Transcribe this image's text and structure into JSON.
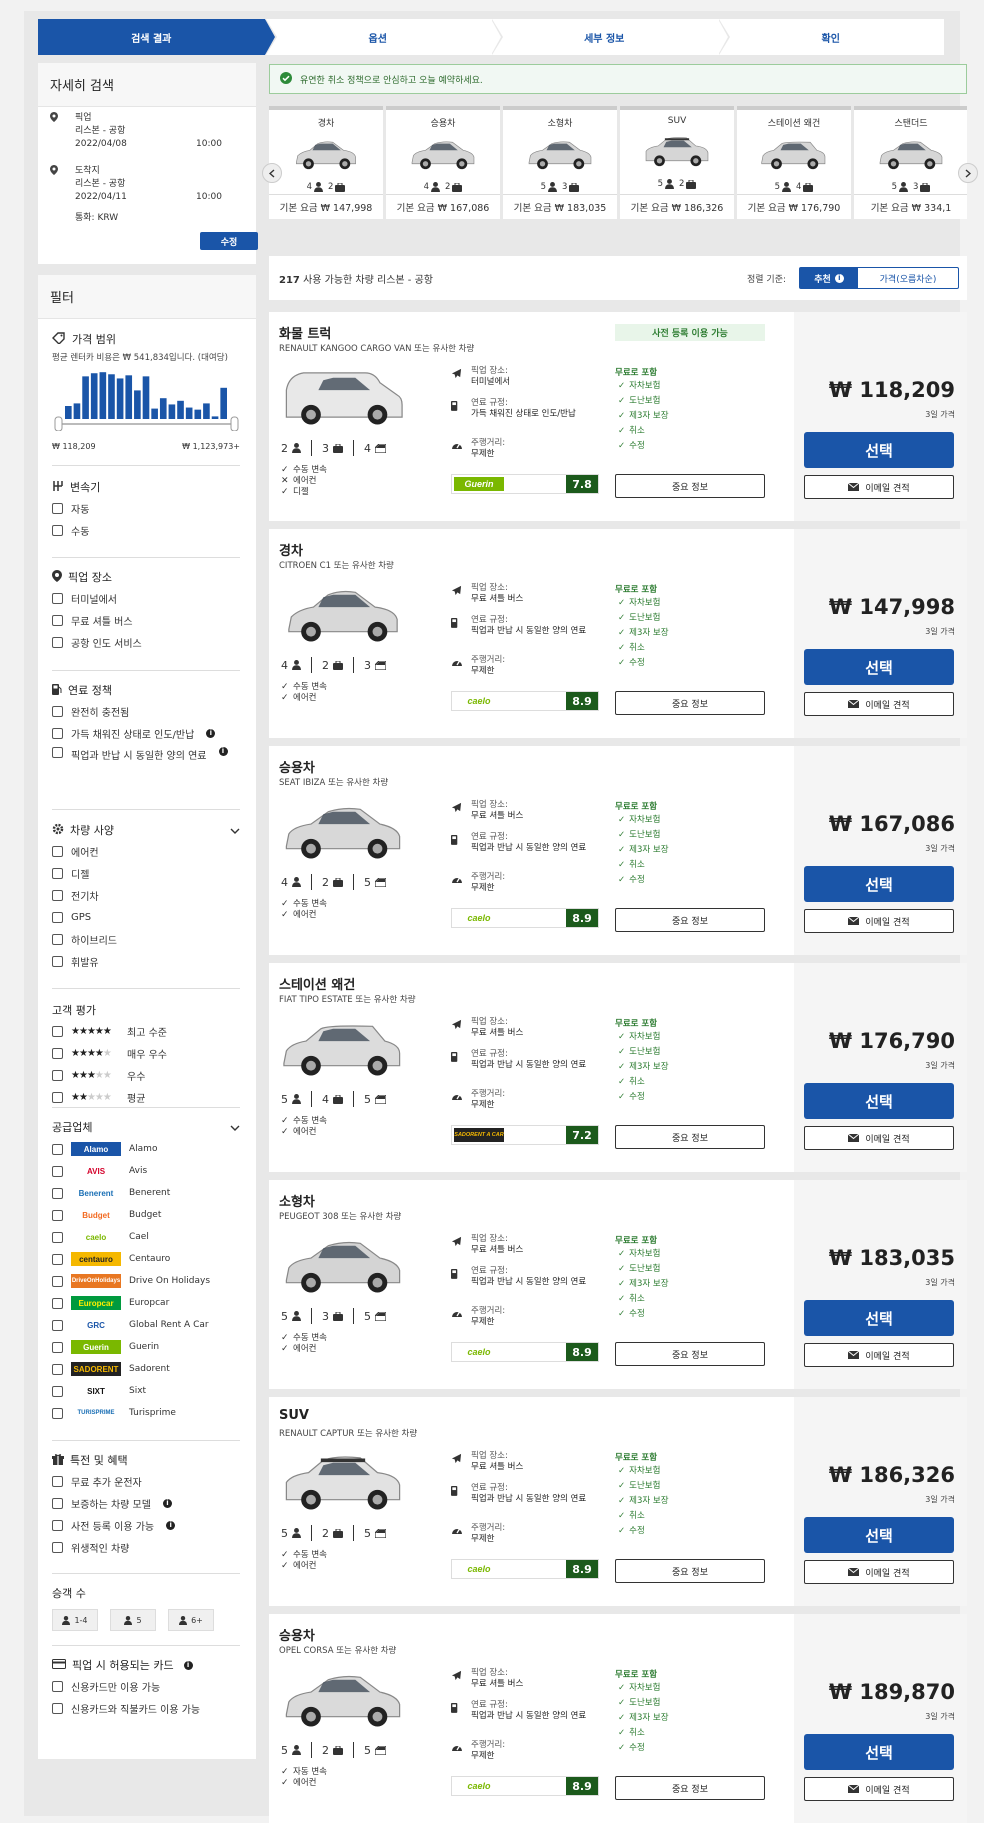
{
  "steps": [
    "검색 결과",
    "옵션",
    "세부 정보",
    "확인"
  ],
  "search": {
    "title": "자세히 검색",
    "pickup_label": "픽업",
    "pickup_location": "리스본 - 공항",
    "pickup_date": "2022/04/08",
    "pickup_time": "10:00",
    "dropoff_label": "도착지",
    "dropoff_location": "리스본 - 공항",
    "dropoff_date": "2022/04/11",
    "dropoff_time": "10:00",
    "currency": "통화: KRW",
    "edit_button": "수정"
  },
  "filters": {
    "title": "필터",
    "price_range": {
      "label": "가격 범위",
      "note": "평균 렌터카 비용은 ₩ 541,834입니다. (대여당)",
      "min": "₩ 118,209",
      "max": "₩ 1,123,973+",
      "histogram": [
        0.25,
        0.3,
        0.82,
        0.88,
        0.9,
        0.86,
        0.78,
        0.84,
        0.55,
        0.82,
        0.2,
        0.4,
        0.28,
        0.35,
        0.22,
        0.18,
        0.3,
        0.05,
        0.6
      ]
    },
    "transmission": {
      "label": "변속기",
      "options": [
        "자동",
        "수동"
      ]
    },
    "pickup_place": {
      "label": "픽업 장소",
      "options": [
        "터미널에서",
        "무료 셔틀 버스",
        "공항 인도 서비스"
      ]
    },
    "fuel_policy": {
      "label": "연료 정책",
      "options": [
        "완전히 충전됨",
        "가득 채워진 상태로 인도/반납",
        "픽업과 반납 시 동일한 양의 연료"
      ]
    },
    "car_features": {
      "label": "차량 사양",
      "options": [
        "에어컨",
        "디젤",
        "전기차",
        "GPS",
        "하이브리드",
        "휘발유"
      ]
    },
    "customer_rating": {
      "label": "고객 평가",
      "options": [
        {
          "stars": 5,
          "label": "최고 수준"
        },
        {
          "stars": 4,
          "label": "매우 우수"
        },
        {
          "stars": 3,
          "label": "우수"
        },
        {
          "stars": 2,
          "label": "평균"
        }
      ]
    },
    "suppliers": {
      "label": "공급업체",
      "options": [
        {
          "name": "Alamo",
          "logo": "Alamo",
          "bg": "#1a55a8",
          "fg": "#fff"
        },
        {
          "name": "Avis",
          "logo": "AVIS",
          "bg": "#fff",
          "fg": "#d4002a"
        },
        {
          "name": "Benerent",
          "logo": "Benerent",
          "bg": "#fff",
          "fg": "#1a6fb5"
        },
        {
          "name": "Budget",
          "logo": "Budget",
          "bg": "#fff",
          "fg": "#f26a21"
        },
        {
          "name": "Cael",
          "logo": "caelo",
          "bg": "#fff",
          "fg": "#7ab800"
        },
        {
          "name": "Centauro",
          "logo": "centauro",
          "bg": "#f5b800",
          "fg": "#222"
        },
        {
          "name": "Drive On Holidays",
          "logo": "DriveOnHolidays",
          "bg": "#e87722",
          "fg": "#fff"
        },
        {
          "name": "Europcar",
          "logo": "Europcar",
          "bg": "#009a3e",
          "fg": "#ffef00"
        },
        {
          "name": "Global Rent A Car",
          "logo": "GRC",
          "bg": "#fff",
          "fg": "#1a55a8"
        },
        {
          "name": "Guerin",
          "logo": "Guerin",
          "bg": "#7ab800",
          "fg": "#fff"
        },
        {
          "name": "Sadorent",
          "logo": "SADORENT",
          "bg": "#222",
          "fg": "#f5b800"
        },
        {
          "name": "Sixt",
          "logo": "SIXT",
          "bg": "#fff",
          "fg": "#111"
        },
        {
          "name": "Turisprime",
          "logo": "TURISPRIME",
          "bg": "#fff",
          "fg": "#1a6fb5"
        }
      ]
    },
    "benefits": {
      "label": "특전 및 혜택",
      "options": [
        "무료 추가 운전자",
        "보증하는 차량 모델",
        "사전 등록 이용 가능",
        "위생적인 차량"
      ]
    },
    "passengers": {
      "label": "승객 수",
      "options": [
        "1-4",
        "5",
        "6+"
      ]
    },
    "cards": {
      "label": "픽업 시 허용되는 카드",
      "options": [
        "신용카드만 이용 가능",
        "신용카드와 직불카드 이용 가능"
      ]
    }
  },
  "banner": "유연한 취소 정책으로 안심하고 오늘 예약하세요.",
  "car_types": [
    {
      "name": "경차",
      "pax": "4",
      "bags": "2",
      "price": "기본 요금 ₩ 147,998"
    },
    {
      "name": "승용차",
      "pax": "4",
      "bags": "2",
      "price": "기본 요금 ₩ 167,086"
    },
    {
      "name": "소형차",
      "pax": "5",
      "bags": "3",
      "price": "기본 요금 ₩ 183,035"
    },
    {
      "name": "SUV",
      "pax": "5",
      "bags": "2",
      "price": "기본 요금 ₩ 186,326"
    },
    {
      "name": "스테이션 왜건",
      "pax": "5",
      "bags": "4",
      "price": "기본 요금 ₩ 176,790"
    },
    {
      "name": "스탠더드",
      "pax": "5",
      "bags": "3",
      "price": "기본 요금 ₩ 334,1"
    }
  ],
  "results": {
    "count": "217",
    "count_text": "사용 가능한 차량 리스본 - 공항",
    "sort_label": "정렬 기준:",
    "sort_recommended": "추천",
    "sort_price": "가격(오름차순)"
  },
  "card_labels": {
    "pickup": "픽업 장소:",
    "fuel": "연료 규정:",
    "mileage": "주행거리:",
    "mileage_value": "무제한",
    "included": "무료로 포함",
    "included_items": [
      "자차보험",
      "도난보험",
      "제3자 보장",
      "취소",
      "수정"
    ],
    "important": "중요 정보",
    "select": "선택",
    "email": "이메일 견적",
    "days": "3일 가격",
    "precheck": "사전 등록 이용 가능"
  },
  "cars": [
    {
      "category": "화물 트럭",
      "model": "RENAULT KANGOO CARGO VAN 또는 유사한 차량",
      "pax": "2",
      "bags": "3",
      "doors": "4",
      "features": [
        {
          "mark": "check",
          "text": "수동 변속"
        },
        {
          "mark": "cross",
          "text": "에어컨"
        },
        {
          "mark": "check",
          "text": "디젤"
        }
      ],
      "pickup": "터미널에서",
      "fuel": "가득 채워진 상태로 인도/반납",
      "supplier": "Guerin",
      "logo_bg": "#7ab800",
      "logo_fg": "#fff",
      "score": "7.8",
      "price": "₩ 118,209",
      "precheck": true,
      "body": "van",
      "color": "#e8e8e8"
    },
    {
      "category": "경차",
      "model": "CITROEN C1 또는 유사한 차량",
      "pax": "4",
      "bags": "2",
      "doors": "3",
      "features": [
        {
          "mark": "check",
          "text": "수동 변속"
        },
        {
          "mark": "check",
          "text": "에어컨"
        }
      ],
      "pickup": "무료 셔틀 버스",
      "fuel": "픽업과 반납 시 동일한 양의 연료",
      "supplier": "caelo",
      "logo_bg": "#fff",
      "logo_fg": "#7ab800",
      "score": "8.9",
      "price": "₩ 147,998",
      "precheck": false,
      "body": "small",
      "color": "#d8d8d8"
    },
    {
      "category": "승용차",
      "model": "SEAT IBIZA 또는 유사한 차량",
      "pax": "4",
      "bags": "2",
      "doors": "5",
      "features": [
        {
          "mark": "check",
          "text": "수동 변속"
        },
        {
          "mark": "check",
          "text": "에어컨"
        }
      ],
      "pickup": "무료 셔틀 버스",
      "fuel": "픽업과 반납 시 동일한 양의 연료",
      "supplier": "caelo",
      "logo_bg": "#fff",
      "logo_fg": "#7ab800",
      "score": "8.9",
      "price": "₩ 167,086",
      "precheck": false,
      "body": "hatch",
      "color": "#d8d8d8"
    },
    {
      "category": "스테이션 왜건",
      "model": "FIAT TIPO ESTATE 또는 유사한 차량",
      "pax": "5",
      "bags": "4",
      "doors": "5",
      "features": [
        {
          "mark": "check",
          "text": "수동 변속"
        },
        {
          "mark": "check",
          "text": "에어컨"
        }
      ],
      "pickup": "무료 셔틀 버스",
      "fuel": "픽업과 반납 시 동일한 양의 연료",
      "supplier": "SADORENT A CAR",
      "logo_bg": "#222",
      "logo_fg": "#f5b800",
      "score": "7.2",
      "price": "₩ 176,790",
      "precheck": false,
      "body": "wagon",
      "color": "#dcdcdc"
    },
    {
      "category": "소형차",
      "model": "PEUGEOT 308 또는 유사한 차량",
      "pax": "5",
      "bags": "3",
      "doors": "5",
      "features": [
        {
          "mark": "check",
          "text": "수동 변속"
        },
        {
          "mark": "check",
          "text": "에어컨"
        }
      ],
      "pickup": "무료 셔틀 버스",
      "fuel": "픽업과 반납 시 동일한 양의 연료",
      "supplier": "caelo",
      "logo_bg": "#fff",
      "logo_fg": "#7ab800",
      "score": "8.9",
      "price": "₩ 183,035",
      "precheck": false,
      "body": "hatch",
      "color": "#d4d4d4"
    },
    {
      "category": "SUV",
      "model": "RENAULT CAPTUR 또는 유사한 차량",
      "pax": "5",
      "bags": "2",
      "doors": "5",
      "features": [
        {
          "mark": "check",
          "text": "수동 변속"
        },
        {
          "mark": "check",
          "text": "에어컨"
        }
      ],
      "pickup": "무료 셔틀 버스",
      "fuel": "픽업과 반납 시 동일한 양의 연료",
      "supplier": "caelo",
      "logo_bg": "#fff",
      "logo_fg": "#7ab800",
      "score": "8.9",
      "price": "₩ 186,326",
      "precheck": false,
      "body": "suv",
      "color": "#e2e2e2"
    },
    {
      "category": "승용차",
      "model": "OPEL CORSA 또는 유사한 차량",
      "pax": "5",
      "bags": "2",
      "doors": "5",
      "features": [
        {
          "mark": "check",
          "text": "자동 변속"
        },
        {
          "mark": "check",
          "text": "에어컨"
        }
      ],
      "pickup": "무료 셔틀 버스",
      "fuel": "픽업과 반납 시 동일한 양의 연료",
      "supplier": "caelo",
      "logo_bg": "#fff",
      "logo_fg": "#7ab800",
      "score": "8.9",
      "price": "₩ 189,870",
      "precheck": false,
      "body": "hatch",
      "color": "#dadada"
    }
  ]
}
